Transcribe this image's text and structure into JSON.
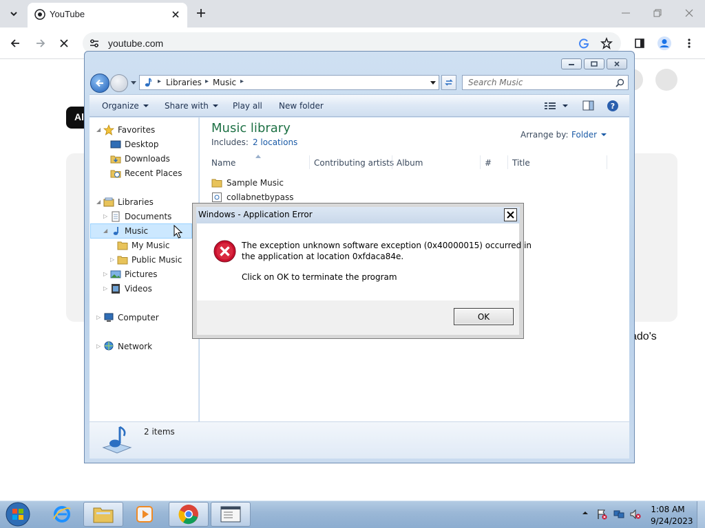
{
  "browser": {
    "tab": {
      "title": "YouTube",
      "icon": "youtube-icon"
    },
    "address": {
      "url": "youtube.com",
      "site_info_icon": "tune-icon"
    },
    "toolbar_icons": [
      "back-arrow-icon",
      "forward-arrow-icon",
      "stop-loading-icon",
      "google-lens-icon",
      "star-icon",
      "side-panel-icon",
      "profile-icon",
      "kebab-menu-icon"
    ]
  },
  "youtube_page": {
    "chip_label": "All",
    "caption_fragment": "ado's"
  },
  "explorer": {
    "breadcrumb": [
      "Libraries",
      "Music"
    ],
    "search_placeholder": "Search Music",
    "commands": {
      "organize": "Organize",
      "share_with": "Share with",
      "play_all": "Play all",
      "new_folder": "New folder"
    },
    "nav": {
      "favorites": "Favorites",
      "desktop": "Desktop",
      "downloads": "Downloads",
      "recent_places": "Recent Places",
      "libraries": "Libraries",
      "documents": "Documents",
      "music": "Music",
      "my_music": "My Music",
      "public_music": "Public Music",
      "pictures": "Pictures",
      "videos": "Videos",
      "computer": "Computer",
      "network": "Network"
    },
    "library": {
      "title": "Music library",
      "includes_label": "Includes:",
      "includes_link": "2 locations",
      "arrange_by_label": "Arrange by:",
      "arrange_by_value": "Folder"
    },
    "columns": {
      "name": "Name",
      "contributing_artists": "Contributing artists",
      "album": "Album",
      "number": "#",
      "title": "Title"
    },
    "files": [
      {
        "name": "Sample Music",
        "icon": "folder-icon"
      },
      {
        "name": "collabnetbypass",
        "icon": "file-icon"
      }
    ],
    "status": {
      "items": "2 items"
    }
  },
  "error_dialog": {
    "title": "Windows - Application Error",
    "message_line1": "The exception unknown software exception (0x40000015) occurred in",
    "message_line2": "the application at location 0xfdaca84e.",
    "message_line3": "Click on OK to terminate the program",
    "ok_label": "OK",
    "icon": "error-icon"
  },
  "taskbar": {
    "time": "1:08 AM",
    "date": "9/24/2023",
    "apps": [
      "internet-explorer-icon",
      "file-explorer-icon",
      "media-player-icon",
      "chrome-icon",
      "app-window-icon"
    ]
  },
  "colors": {
    "library_title": "#1e7145",
    "link": "#1a5aa6",
    "selection": "#cce8ff",
    "error_red": "#c8102e"
  }
}
